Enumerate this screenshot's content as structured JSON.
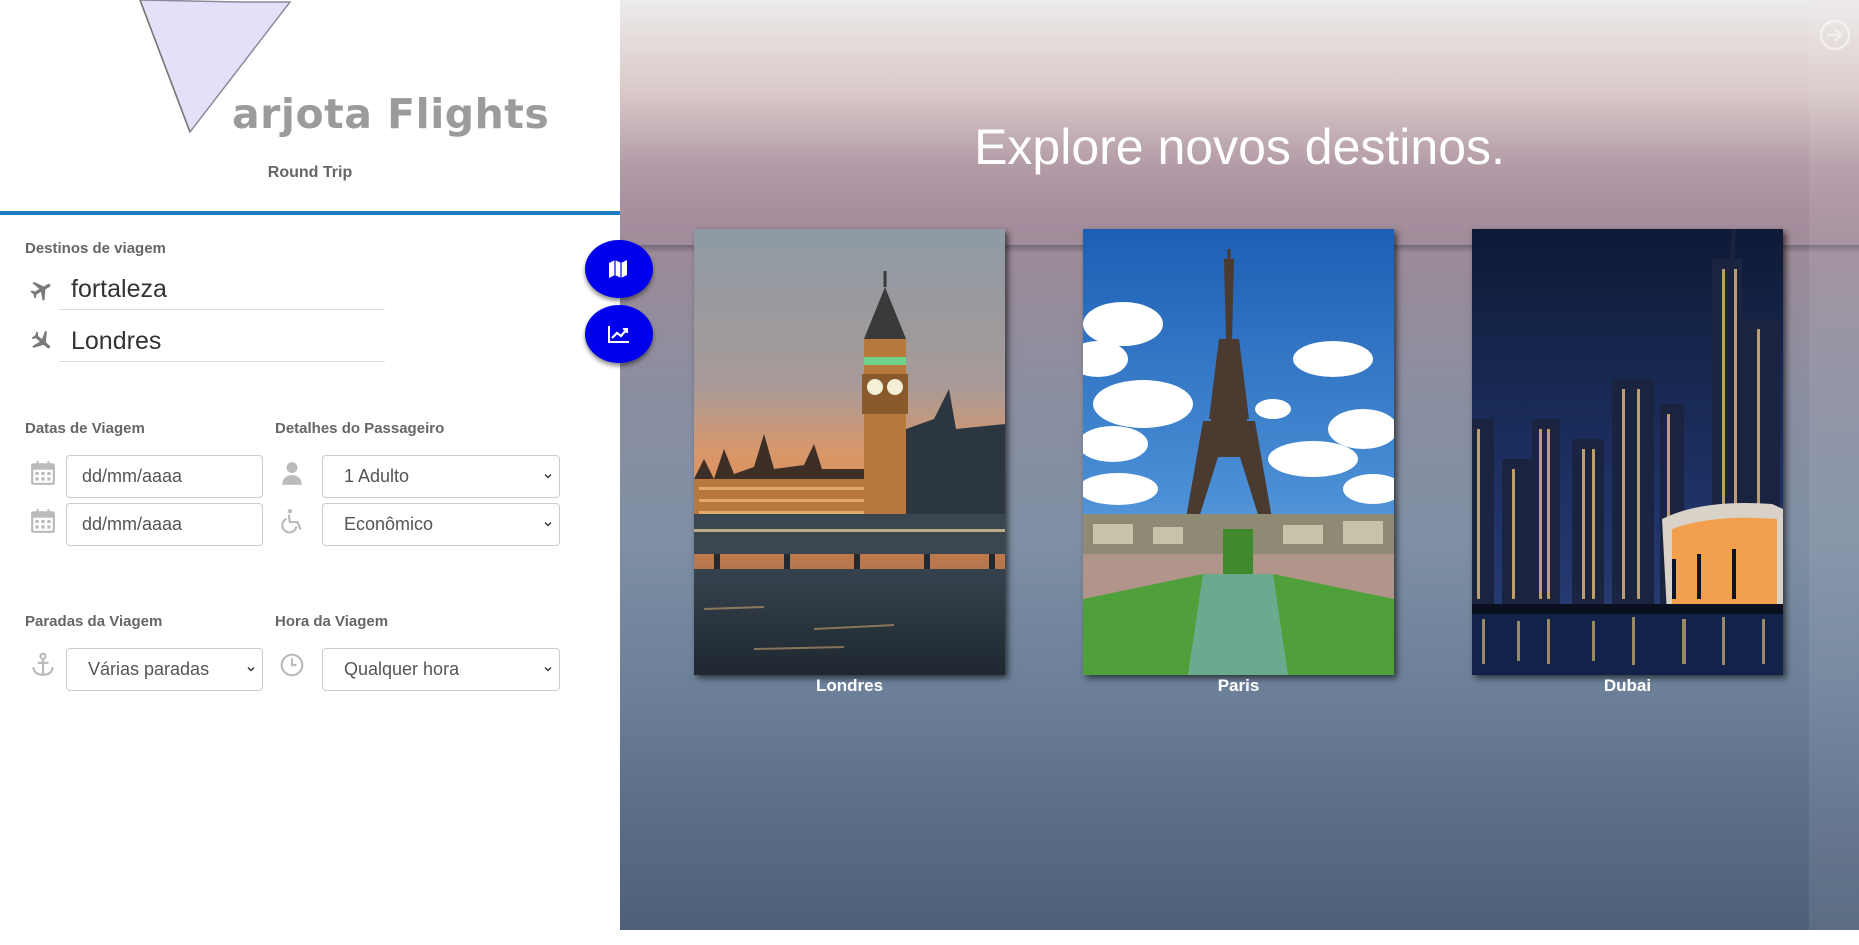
{
  "brand": {
    "logo_text": "arjota Flights",
    "trip_type": "Round Trip"
  },
  "destinations": {
    "label": "Destinos de viagem",
    "origin": "fortaleza",
    "destination": "Londres",
    "origin_icon": "plane-takeoff-icon",
    "destination_icon": "plane-landing-icon"
  },
  "dates": {
    "label": "Datas de Viagem",
    "departure_placeholder": "dd/mm/aaaa",
    "return_placeholder": "dd/mm/aaaa",
    "icon": "calendar-icon"
  },
  "passenger": {
    "label": "Detalhes do Passageiro",
    "count": "1 Adulto",
    "class": "Econômico",
    "icons": [
      "person-icon",
      "wheelchair-icon"
    ]
  },
  "stops": {
    "label": "Paradas da Viagem",
    "value": "Várias paradas",
    "icon": "anchor-icon"
  },
  "time": {
    "label": "Hora da Viagem",
    "value": "Qualquer hora",
    "icon": "clock-icon"
  },
  "fab_buttons": [
    "map-icon",
    "chart-line-icon"
  ],
  "hero": {
    "title": "Explore novos destinos.",
    "corner_icon": "sign-in-icon",
    "cards": [
      {
        "name": "Londres"
      },
      {
        "name": "Paris"
      },
      {
        "name": "Dubai"
      }
    ]
  },
  "colors": {
    "accent": "#1e7cc0",
    "fab": "#0000ee",
    "logo_fill": "#e1dcf8"
  }
}
